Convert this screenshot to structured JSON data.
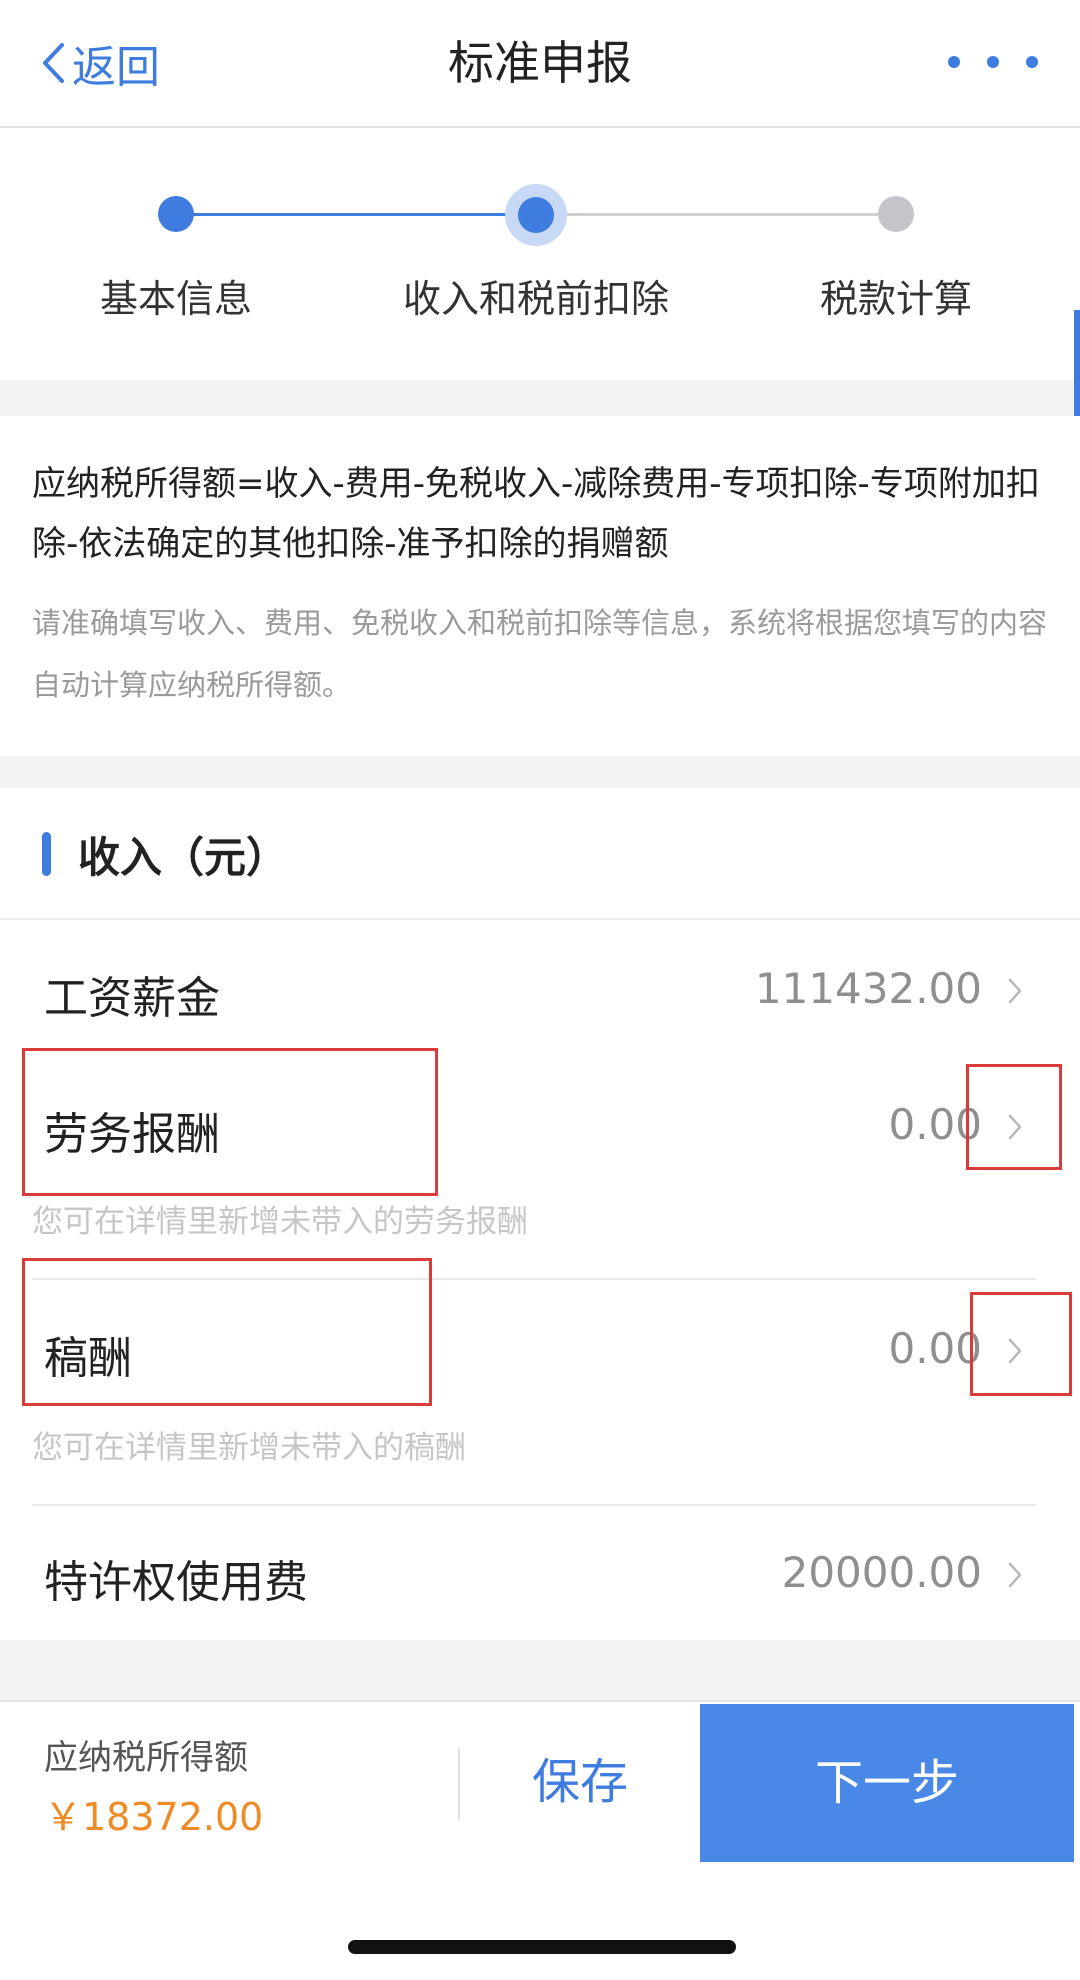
{
  "navbar": {
    "back_label": "返回",
    "title": "标准申报"
  },
  "stepper": {
    "steps": [
      {
        "label": "基本信息",
        "state": "done"
      },
      {
        "label": "收入和税前扣除",
        "state": "current"
      },
      {
        "label": "税款计算",
        "state": "todo"
      }
    ]
  },
  "formula": {
    "text": "应纳税所得额=收入-费用-免税收入-减除费用-专项扣除-专项附加扣除-依法确定的其他扣除-准予扣除的捐赠额",
    "note": "请准确填写收入、费用、免税收入和税前扣除等信息，系统将根据您填写的内容自动计算应纳税所得额。"
  },
  "income_section": {
    "title": "收入（元）",
    "rows": [
      {
        "label": "工资薪金",
        "value": "111432.00",
        "hint": ""
      },
      {
        "label": "劳务报酬",
        "value": "0.00",
        "hint": "您可在详情里新增未带入的劳务报酬"
      },
      {
        "label": "稿酬",
        "value": "0.00",
        "hint": "您可在详情里新增未带入的稿酬"
      },
      {
        "label": "特许权使用费",
        "value": "20000.00",
        "hint": ""
      }
    ]
  },
  "bottom_bar": {
    "taxable_label": "应纳税所得额",
    "taxable_amount": "￥18372.00",
    "save_label": "保存",
    "next_label": "下一步"
  },
  "colors": {
    "accent": "#3f7ce0",
    "primary_button": "#4a88e8",
    "amount": "#f08a24",
    "annotation_box": "#d93a3a"
  },
  "icons": [
    "chevron-left-icon",
    "more-dots-icon",
    "chevron-right-icon"
  ]
}
